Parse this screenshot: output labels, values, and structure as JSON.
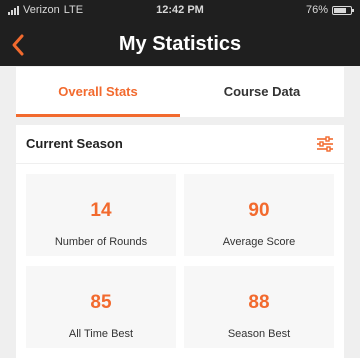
{
  "status_bar": {
    "carrier": "Verizon",
    "network": "LTE",
    "time": "12:42 PM",
    "battery": "76%"
  },
  "header": {
    "title": "My Statistics"
  },
  "tabs": [
    {
      "label": "Overall Stats",
      "active": true
    },
    {
      "label": "Course Data",
      "active": false
    }
  ],
  "season": {
    "label": "Current Season"
  },
  "stats": [
    {
      "value": "14",
      "label": "Number of Rounds"
    },
    {
      "value": "90",
      "label": "Average Score"
    },
    {
      "value": "85",
      "label": "All Time Best"
    },
    {
      "value": "88",
      "label": "Season Best"
    }
  ],
  "icons": {
    "back": "chevron-left-icon",
    "filter": "sliders-icon"
  },
  "colors": {
    "accent": "#f26a2e",
    "header_bg": "#1f1f1f",
    "page_bg": "#efefef"
  }
}
